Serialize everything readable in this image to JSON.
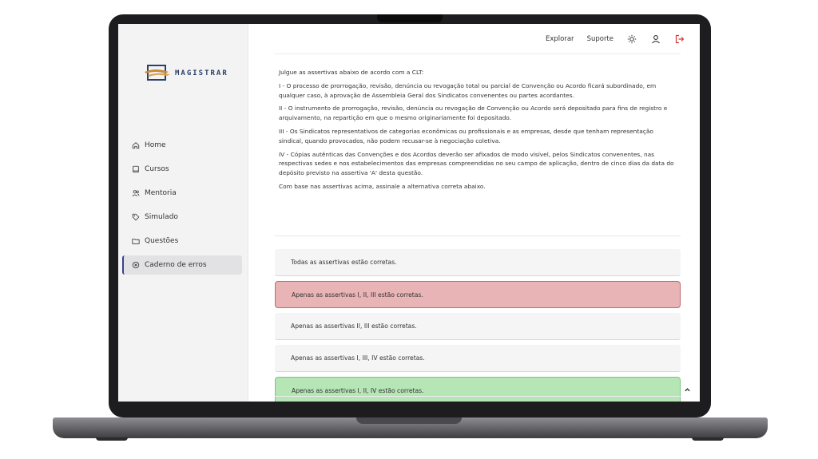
{
  "brand": {
    "name": "MAGISTRAR"
  },
  "topbar": {
    "explore_label": "Explorar",
    "support_label": "Suporte"
  },
  "sidebar": {
    "items": [
      {
        "label": "Home",
        "icon": "home-icon"
      },
      {
        "label": "Cursos",
        "icon": "book-icon"
      },
      {
        "label": "Mentoria",
        "icon": "users-icon"
      },
      {
        "label": "Simulado",
        "icon": "tag-icon"
      },
      {
        "label": "Questões",
        "icon": "folder-icon"
      },
      {
        "label": "Caderno de erros",
        "icon": "circle-x-icon",
        "active": true
      }
    ]
  },
  "question": {
    "intro": "Julgue as assertivas abaixo de acordo com a CLT:",
    "statements": [
      "I - O processo de prorrogação, revisão, denúncia ou revogação total ou parcial de Convenção ou Acordo ficará subordinado, em qualquer caso, à aprovação de Assembleia Geral dos Sindicatos convenentes ou partes acordantes.",
      "II - O instrumento de prorrogação, revisão, denúncia ou revogação de Convenção ou Acordo será depositado para fins de registro e arquivamento, na repartição em que o mesmo originariamente foi depositado.",
      "III - Os Sindicatos representativos de categorias econômicas ou profissionais e as empresas, desde que tenham representação sindical, quando provocados, não podem recusar-se à negociação coletiva.",
      "IV - Cópias autênticas das Convenções e dos Acordos deverão ser afixados de modo visível, pelos Sindicatos convenentes, nas respectivas sedes e nos estabelecimentos das empresas compreendidas no seu campo de aplicação, dentro de cinco dias da data do depósito previsto na assertiva 'A' desta questão."
    ],
    "closing": "Com base nas assertivas acima, assinale a alternativa correta abaixo."
  },
  "options": [
    {
      "label": "Todas as assertivas estão corretas.",
      "state": "neutral"
    },
    {
      "label": "Apenas as assertivas I, II, III estão corretas.",
      "state": "wrong"
    },
    {
      "label": "Apenas as assertivas II, III estão corretas.",
      "state": "neutral"
    },
    {
      "label": "Apenas as assertivas I, III, IV estão corretas.",
      "state": "neutral"
    },
    {
      "label": "Apenas as assertivas I, II, IV estão corretas.",
      "state": "right"
    }
  ],
  "colors": {
    "wrong_bg": "#e8b4b5",
    "right_bg": "#b6e5b6",
    "accent": "#3a3f8f",
    "logout": "#d33b3b"
  }
}
